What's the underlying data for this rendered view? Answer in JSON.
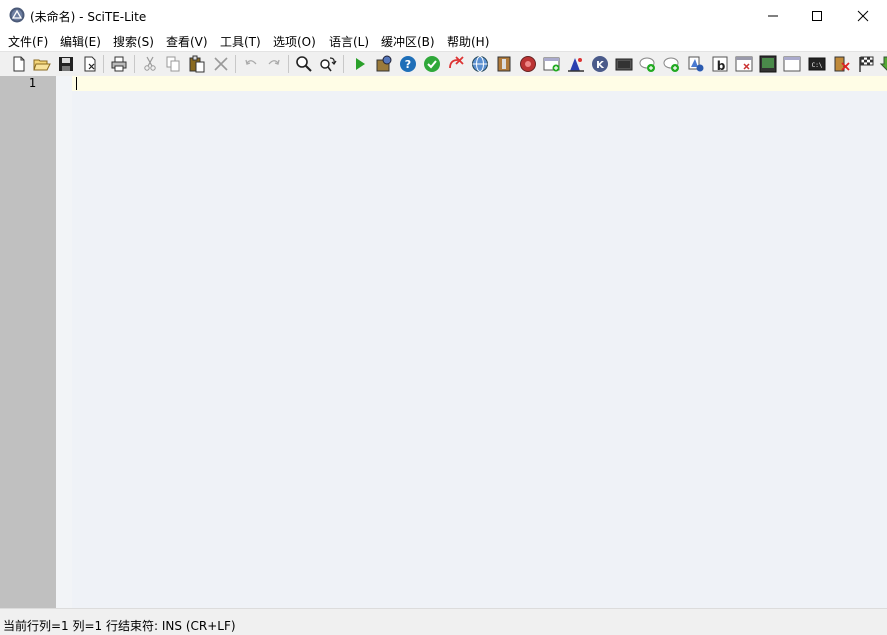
{
  "window": {
    "title": "(未命名) - SciTE-Lite",
    "minimize_icon": "minimize-icon",
    "maximize_icon": "maximize-icon",
    "close_icon": "close-icon"
  },
  "menu": {
    "items": [
      {
        "label": "文件(F)"
      },
      {
        "label": "编辑(E)"
      },
      {
        "label": "搜索(S)"
      },
      {
        "label": "查看(V)"
      },
      {
        "label": "工具(T)"
      },
      {
        "label": "选项(O)"
      },
      {
        "label": "语言(L)"
      },
      {
        "label": "缓冲区(B)"
      },
      {
        "label": "帮助(H)"
      }
    ]
  },
  "toolbar": {
    "buttons": [
      {
        "icon": "new-file-icon"
      },
      {
        "icon": "open-folder-icon"
      },
      {
        "icon": "save-icon"
      },
      {
        "icon": "close-file-icon"
      },
      {
        "icon": "print-icon"
      },
      {
        "icon": "cut-icon"
      },
      {
        "icon": "copy-icon"
      },
      {
        "icon": "paste-icon"
      },
      {
        "icon": "delete-icon"
      },
      {
        "icon": "undo-icon"
      },
      {
        "icon": "redo-icon"
      },
      {
        "icon": "find-icon"
      },
      {
        "icon": "replace-icon"
      },
      {
        "icon": "run-icon"
      },
      {
        "icon": "compile-icon"
      },
      {
        "icon": "help-icon"
      },
      {
        "icon": "check-icon"
      },
      {
        "icon": "stop-icon"
      },
      {
        "icon": "globe-icon"
      },
      {
        "icon": "column-icon"
      },
      {
        "icon": "record-icon"
      },
      {
        "icon": "new-window-icon"
      },
      {
        "icon": "wizard-icon"
      },
      {
        "icon": "k-icon"
      },
      {
        "icon": "panel-icon"
      },
      {
        "icon": "bubble-add-icon"
      },
      {
        "icon": "bubble-add-2-icon"
      },
      {
        "icon": "shapes-icon"
      },
      {
        "icon": "b-icon"
      },
      {
        "icon": "window-close-icon"
      },
      {
        "icon": "terminal-icon"
      },
      {
        "icon": "blank-window-icon"
      },
      {
        "icon": "console-icon"
      },
      {
        "icon": "exit-icon"
      },
      {
        "icon": "flag-icon"
      },
      {
        "icon": "download-icon"
      }
    ]
  },
  "editor": {
    "line_numbers": [
      "1"
    ],
    "content": "",
    "colors": {
      "margin": "#c0c0c0",
      "background": "#eff2f7",
      "caret_line": "#fffde6"
    }
  },
  "status": {
    "text": "当前行列=1 列=1 行结束符: INS (CR+LF)"
  }
}
